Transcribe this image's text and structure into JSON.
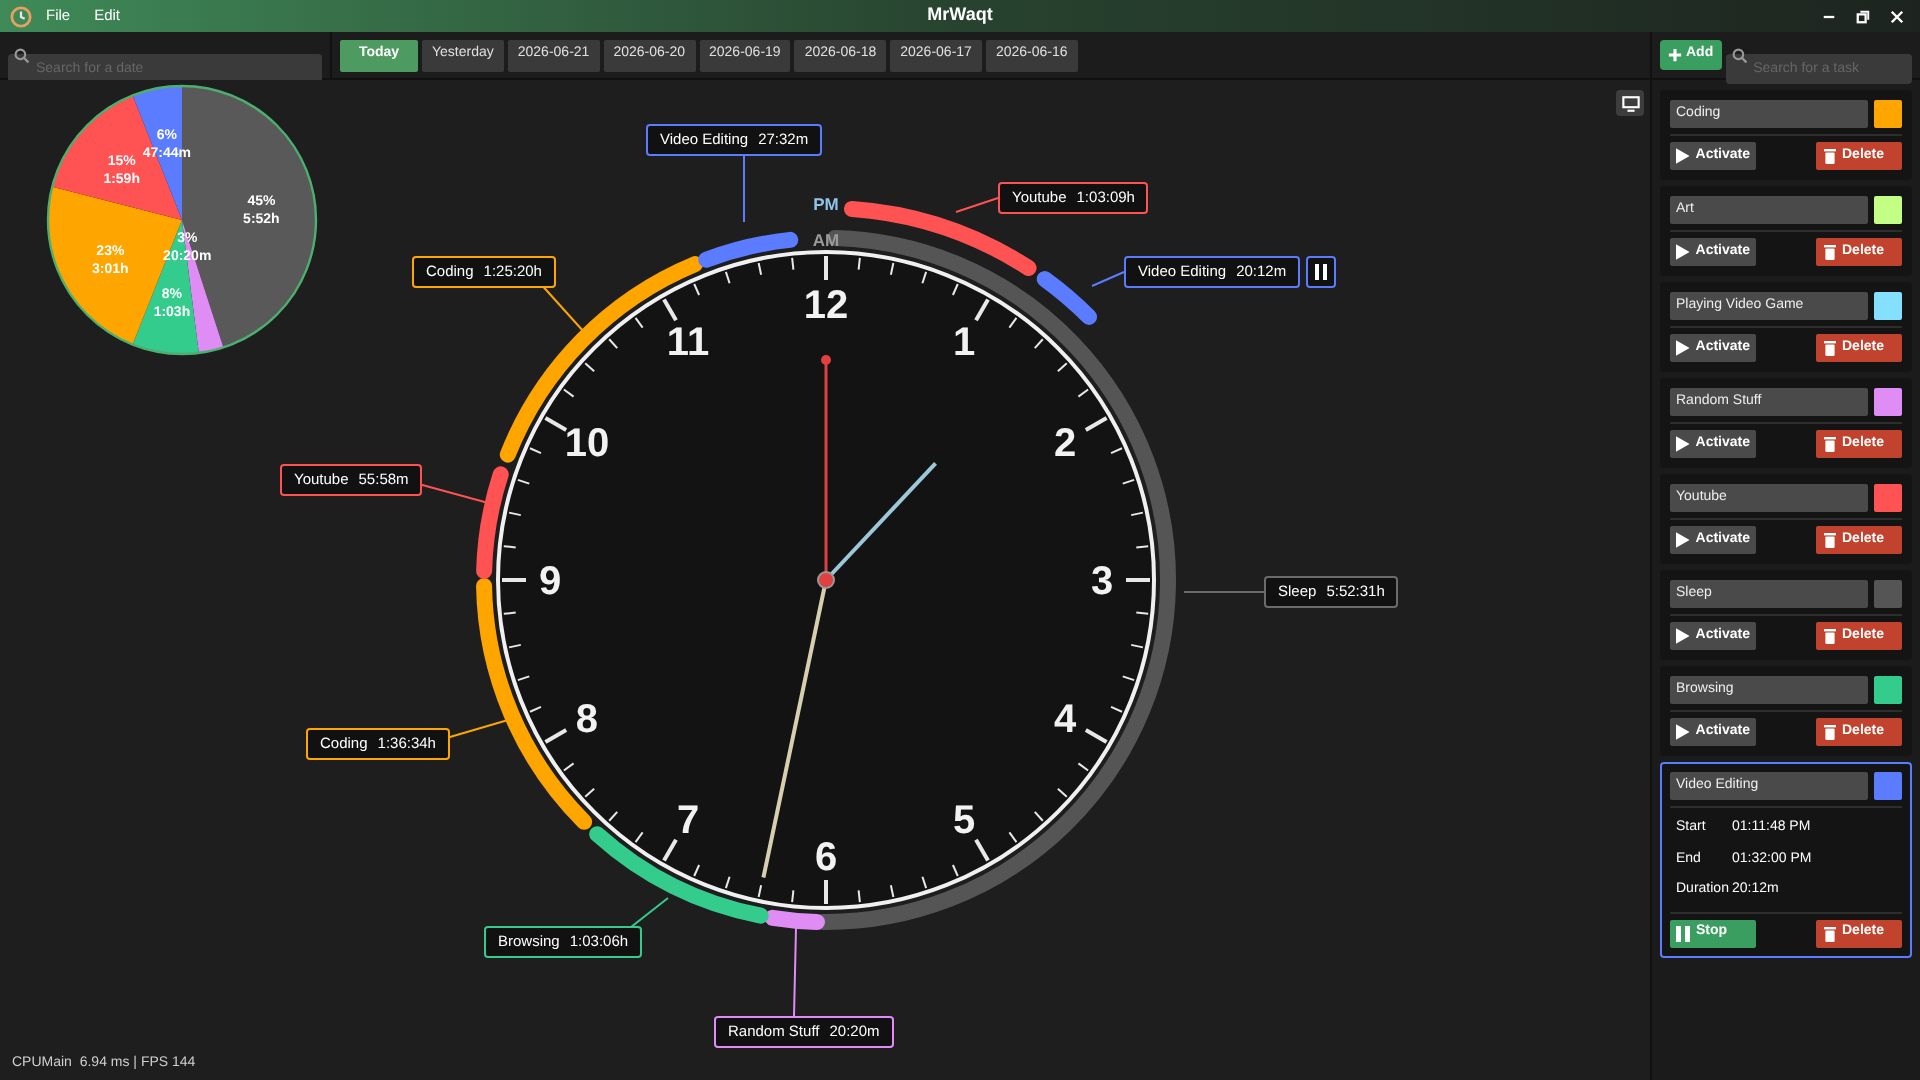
{
  "window": {
    "title": "MrWaqt",
    "menu": [
      "File",
      "Edit"
    ]
  },
  "date_search": {
    "placeholder": "Search for a date"
  },
  "date_tabs": [
    {
      "label": "Today",
      "selected": true
    },
    {
      "label": "Yesterday",
      "selected": false
    },
    {
      "label": "2026-06-21",
      "selected": false
    },
    {
      "label": "2026-06-20",
      "selected": false
    },
    {
      "label": "2026-06-19",
      "selected": false
    },
    {
      "label": "2026-06-18",
      "selected": false
    },
    {
      "label": "2026-06-17",
      "selected": false
    },
    {
      "label": "2026-06-16",
      "selected": false
    }
  ],
  "add_button": "Add",
  "task_search": {
    "placeholder": "Search for a task"
  },
  "pie": {
    "chart_data": {
      "type": "pie",
      "values": [
        45,
        3,
        8,
        23,
        15,
        6
      ],
      "colors": [
        "#595959",
        "#e08cf5",
        "#33cc8c",
        "#ffa500",
        "#ff5252",
        "#5b7cff"
      ],
      "value_labels": [
        [
          "45%",
          "5:52h"
        ],
        [
          "3%",
          "20:20m"
        ],
        [
          "8%",
          "1:03h"
        ],
        [
          "23%",
          "3:01h"
        ],
        [
          "15%",
          "1:59h"
        ],
        [
          "6%",
          "47:44m"
        ]
      ]
    }
  },
  "clock": {
    "pm_label": "PM",
    "am_label": "AM",
    "numbers": [
      "12",
      "1",
      "2",
      "3",
      "4",
      "5",
      "6",
      "7",
      "8",
      "9",
      "10",
      "11"
    ],
    "segments": [
      {
        "kind": "am",
        "color": "#555555"
      },
      {
        "kind": "am",
        "color": "#e08cf5"
      },
      {
        "kind": "am",
        "color": "#33cc8c"
      },
      {
        "kind": "am",
        "color": "#ffa500"
      },
      {
        "kind": "am",
        "color": "#ff5252"
      },
      {
        "kind": "am",
        "color": "#ffa500"
      },
      {
        "kind": "am",
        "color": "#5b7cff"
      },
      {
        "kind": "pm",
        "color": "#ff5252"
      },
      {
        "kind": "pm",
        "color": "#5b7cff"
      }
    ],
    "callouts": [
      {
        "running": false,
        "task": "Video Editing",
        "duration": "27:32m",
        "color": "#5b7cff"
      },
      {
        "running": false,
        "task": "Youtube",
        "duration": "1:03:09h",
        "color": "#ff5252"
      },
      {
        "running": false,
        "task": "Coding",
        "duration": "1:25:20h",
        "color": "#ffa500"
      },
      {
        "running": true,
        "task": "Video Editing",
        "duration": "20:12m",
        "color": "#5b7cff"
      },
      {
        "running": false,
        "task": "Youtube",
        "duration": "55:58m",
        "color": "#ff5252"
      },
      {
        "running": false,
        "task": "Sleep",
        "duration": "5:52:31h",
        "color": "#6b6b6b"
      },
      {
        "running": false,
        "task": "Coding",
        "duration": "1:36:34h",
        "color": "#ffa500"
      },
      {
        "running": false,
        "task": "Browsing",
        "duration": "1:03:06h",
        "color": "#33cc8c"
      },
      {
        "running": false,
        "task": "Random Stuff",
        "duration": "20:20m",
        "color": "#e08cf5"
      }
    ]
  },
  "tasks": [
    {
      "name": "Coding",
      "color": "#ffa500",
      "active": false,
      "primary_button": "Activate",
      "delete_button": "Delete"
    },
    {
      "name": "Art",
      "color": "#c4ff85",
      "active": false,
      "primary_button": "Activate",
      "delete_button": "Delete"
    },
    {
      "name": "Playing Video Game",
      "color": "#85e0ff",
      "active": false,
      "primary_button": "Activate",
      "delete_button": "Delete"
    },
    {
      "name": "Random Stuff",
      "color": "#e08cf5",
      "active": false,
      "primary_button": "Activate",
      "delete_button": "Delete"
    },
    {
      "name": "Youtube",
      "color": "#ff5252",
      "active": false,
      "primary_button": "Activate",
      "delete_button": "Delete"
    },
    {
      "name": "Sleep",
      "color": "#555555",
      "active": false,
      "primary_button": "Activate",
      "delete_button": "Delete"
    },
    {
      "name": "Browsing",
      "color": "#33cc8c",
      "active": false,
      "primary_button": "Activate",
      "delete_button": "Delete"
    },
    {
      "name": "Video Editing",
      "color": "#5b7cff",
      "active": true,
      "details": [
        {
          "label": "Start",
          "value": "01:11:48 PM"
        },
        {
          "label": "End",
          "value": "01:32:00 PM"
        },
        {
          "label": "Duration",
          "value": "20:12m"
        }
      ],
      "primary_button": "Stop",
      "delete_button": "Delete"
    }
  ],
  "status_bar": "CPUMain  6.94 ms | FPS 144"
}
